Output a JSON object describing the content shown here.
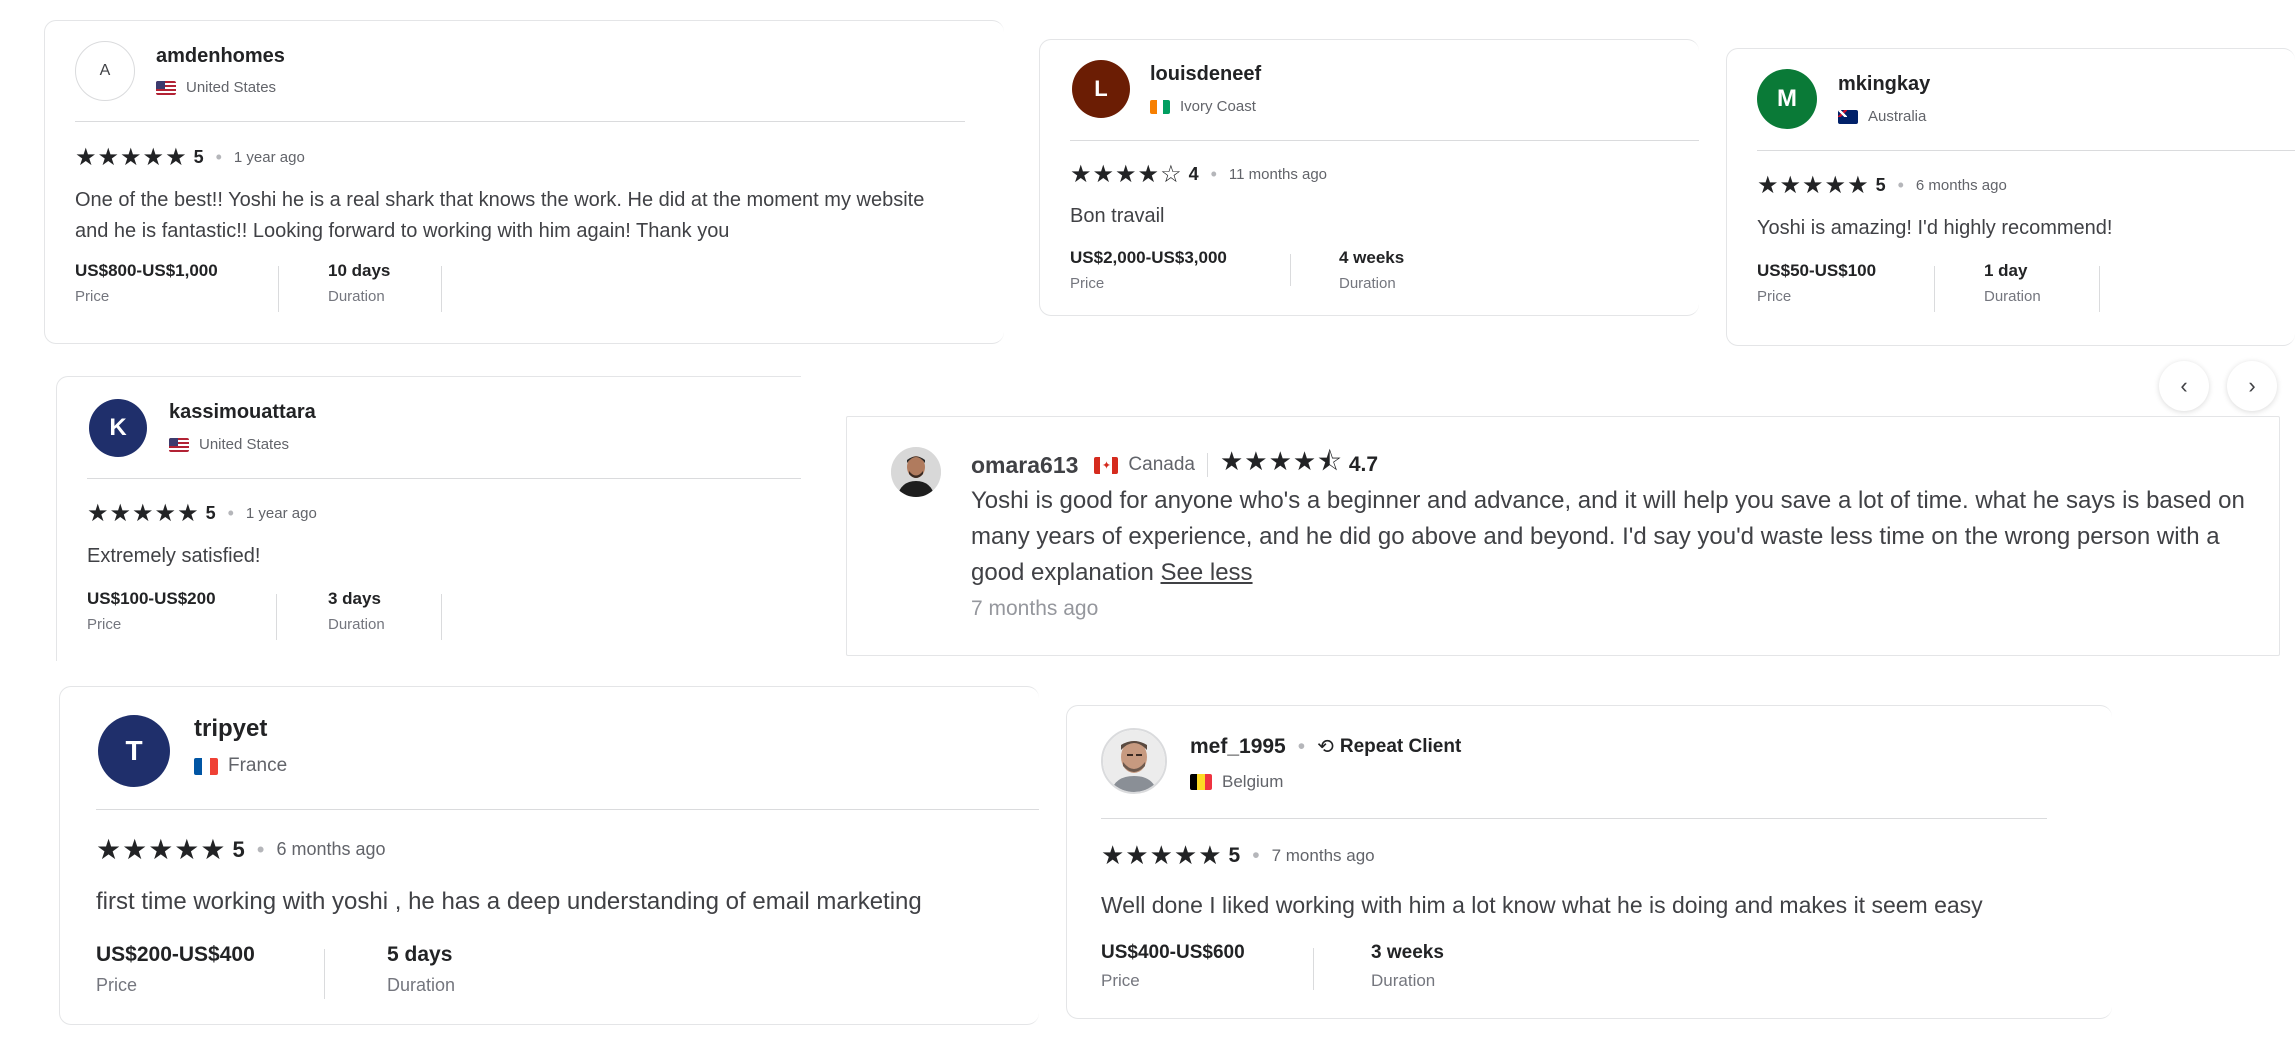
{
  "reviews": [
    {
      "initial": "A",
      "username": "amdenhomes",
      "country": "United States",
      "stars": "★★★★★",
      "score": "5",
      "time": "1 year ago",
      "text": "One of the best!! Yoshi he is a real shark that knows the work. He did at the moment my website and he is fantastic!! Looking forward to working with him again! Thank you",
      "price": "US$800-US$1,000",
      "price_label": "Price",
      "duration": "10 days",
      "duration_label": "Duration"
    },
    {
      "initial": "L",
      "username": "louisdeneef",
      "country": "Ivory Coast",
      "stars": "★★★★☆",
      "score": "4",
      "time": "11 months ago",
      "text": "Bon travail",
      "price": "US$2,000-US$3,000",
      "price_label": "Price",
      "duration": "4 weeks",
      "duration_label": "Duration"
    },
    {
      "initial": "M",
      "username": "mkingkay",
      "country": "Australia",
      "stars": "★★★★★",
      "score": "5",
      "time": "6 months ago",
      "text": "Yoshi is amazing! I'd highly recommend!",
      "price": "US$50-US$100",
      "price_label": "Price",
      "duration": "1 day",
      "duration_label": "Duration"
    },
    {
      "initial": "K",
      "username": "kassimouattara",
      "country": "United States",
      "stars": "★★★★★",
      "score": "5",
      "time": "1 year ago",
      "text": "Extremely satisfied!",
      "price": "US$100-US$200",
      "price_label": "Price",
      "duration": "3 days",
      "duration_label": "Duration"
    },
    {
      "username": "omara613",
      "country": "Canada",
      "stars": "★★★★⯪",
      "score": "4.7",
      "text": "Yoshi is good for anyone who's a beginner and advance, and it will help you save a lot of time. what he says is based on many years of experience, and he did go above and beyond. I'd say you'd waste less time on the wrong person with a good explanation",
      "see_less": "See less",
      "time": "7 months ago"
    },
    {
      "initial": "T",
      "username": "tripyet",
      "country": "France",
      "stars": "★★★★★",
      "score": "5",
      "time": "6 months ago",
      "text": "first time working with yoshi , he has a deep understanding of email marketing",
      "price": "US$200-US$400",
      "price_label": "Price",
      "duration": "5 days",
      "duration_label": "Duration"
    },
    {
      "username": "mef_1995",
      "repeat": "Repeat Client",
      "country": "Belgium",
      "stars": "★★★★★",
      "score": "5",
      "time": "7 months ago",
      "text": "Well done I liked working with him a lot know what he is doing and makes it seem easy",
      "price": "US$400-US$600",
      "price_label": "Price",
      "duration": "3 weeks",
      "duration_label": "Duration"
    }
  ],
  "nav": {
    "prev": "‹",
    "next": "›"
  },
  "colors": {
    "avatar_border": "#dadbdd",
    "brown": "#6b1d04",
    "green": "#0a7a37",
    "navy": "#1f2f6b"
  }
}
